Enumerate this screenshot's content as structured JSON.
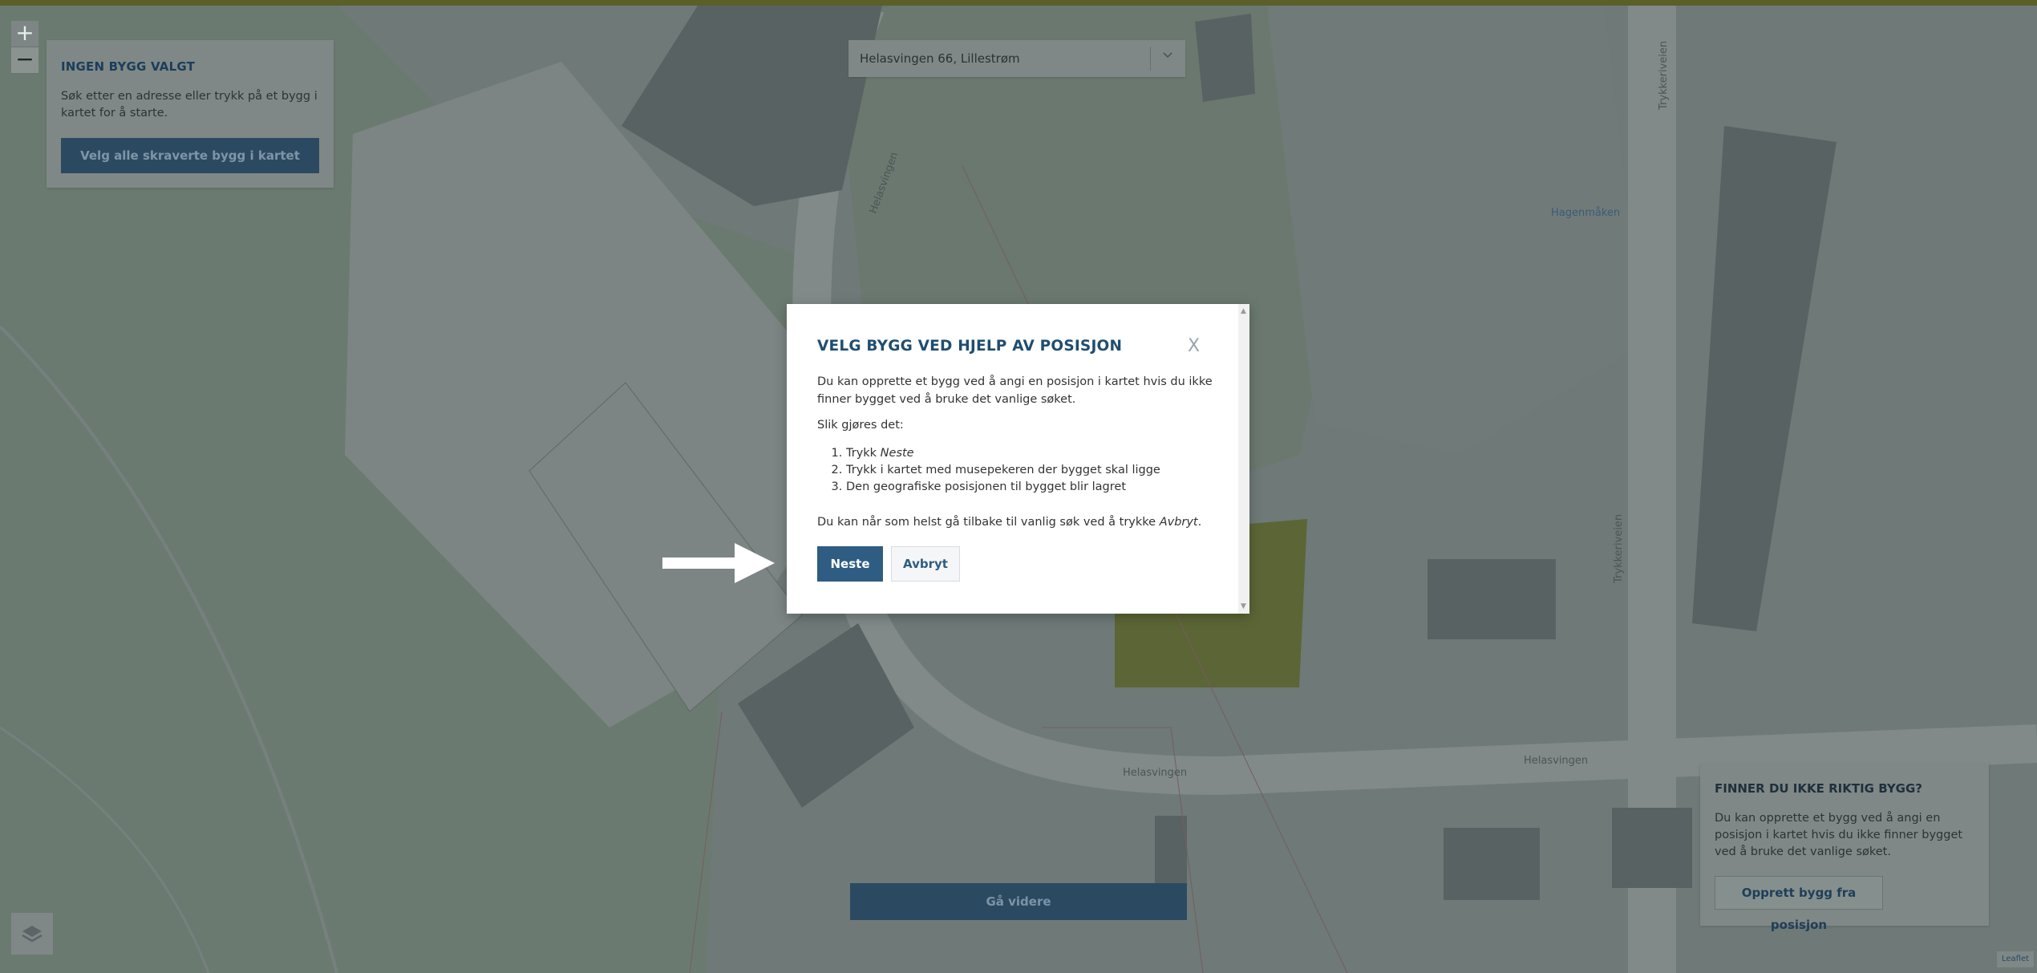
{
  "zoom": {
    "in_label": "+",
    "out_label": "−"
  },
  "left_panel": {
    "title": "INGEN BYGG VALGT",
    "description": "Søk etter en adresse eller trykk på et bygg i kartet for å starte.",
    "select_all_button": "Velg alle skraverte bygg i kartet"
  },
  "address_search": {
    "value": "Helasvingen 66, Lillestrøm",
    "dropdown_icon": "chevron-down-icon"
  },
  "modal": {
    "title": "VELG BYGG VED HJELP AV POSISJON",
    "close_label": "X",
    "intro": "Du kan opprette et bygg ved å angi en posisjon i kartet hvis du ikke finner bygget ved å bruke det vanlige søket.",
    "how_to": "Slik gjøres det:",
    "step1_prefix": "Trykk ",
    "step1_em": "Neste",
    "step2": "Trykk i kartet med musepekeren der bygget skal ligge",
    "step3": "Den geografiske posisjonen til bygget blir lagret",
    "outro_prefix": "Du kan når som helst gå tilbake til vanlig søk ved å trykke ",
    "outro_em": "Avbryt",
    "outro_suffix": ".",
    "next_button": "Neste",
    "cancel_button": "Avbryt"
  },
  "right_panel": {
    "title": "FINNER DU IKKE RIKTIG BYGG?",
    "description": "Du kan opprette et bygg ved å angi en posisjon i kartet hvis du ikke finner bygget ved å bruke det vanlige søket.",
    "create_button": "Opprett bygg fra posisjon"
  },
  "continue_button": "Gå videre",
  "attribution": "Leaflet",
  "map_labels": {
    "road1": "Helasvingen",
    "road2": "Helasvingen",
    "road3": "Helasvingen",
    "road4": "Trykkeriveien",
    "road5": "Trykkeriveien",
    "place": "Hagenmåken"
  },
  "colors": {
    "primary": "#2e5c82",
    "title_blue": "#1f4e70",
    "dim_overlay_panel": "#7f8886"
  }
}
